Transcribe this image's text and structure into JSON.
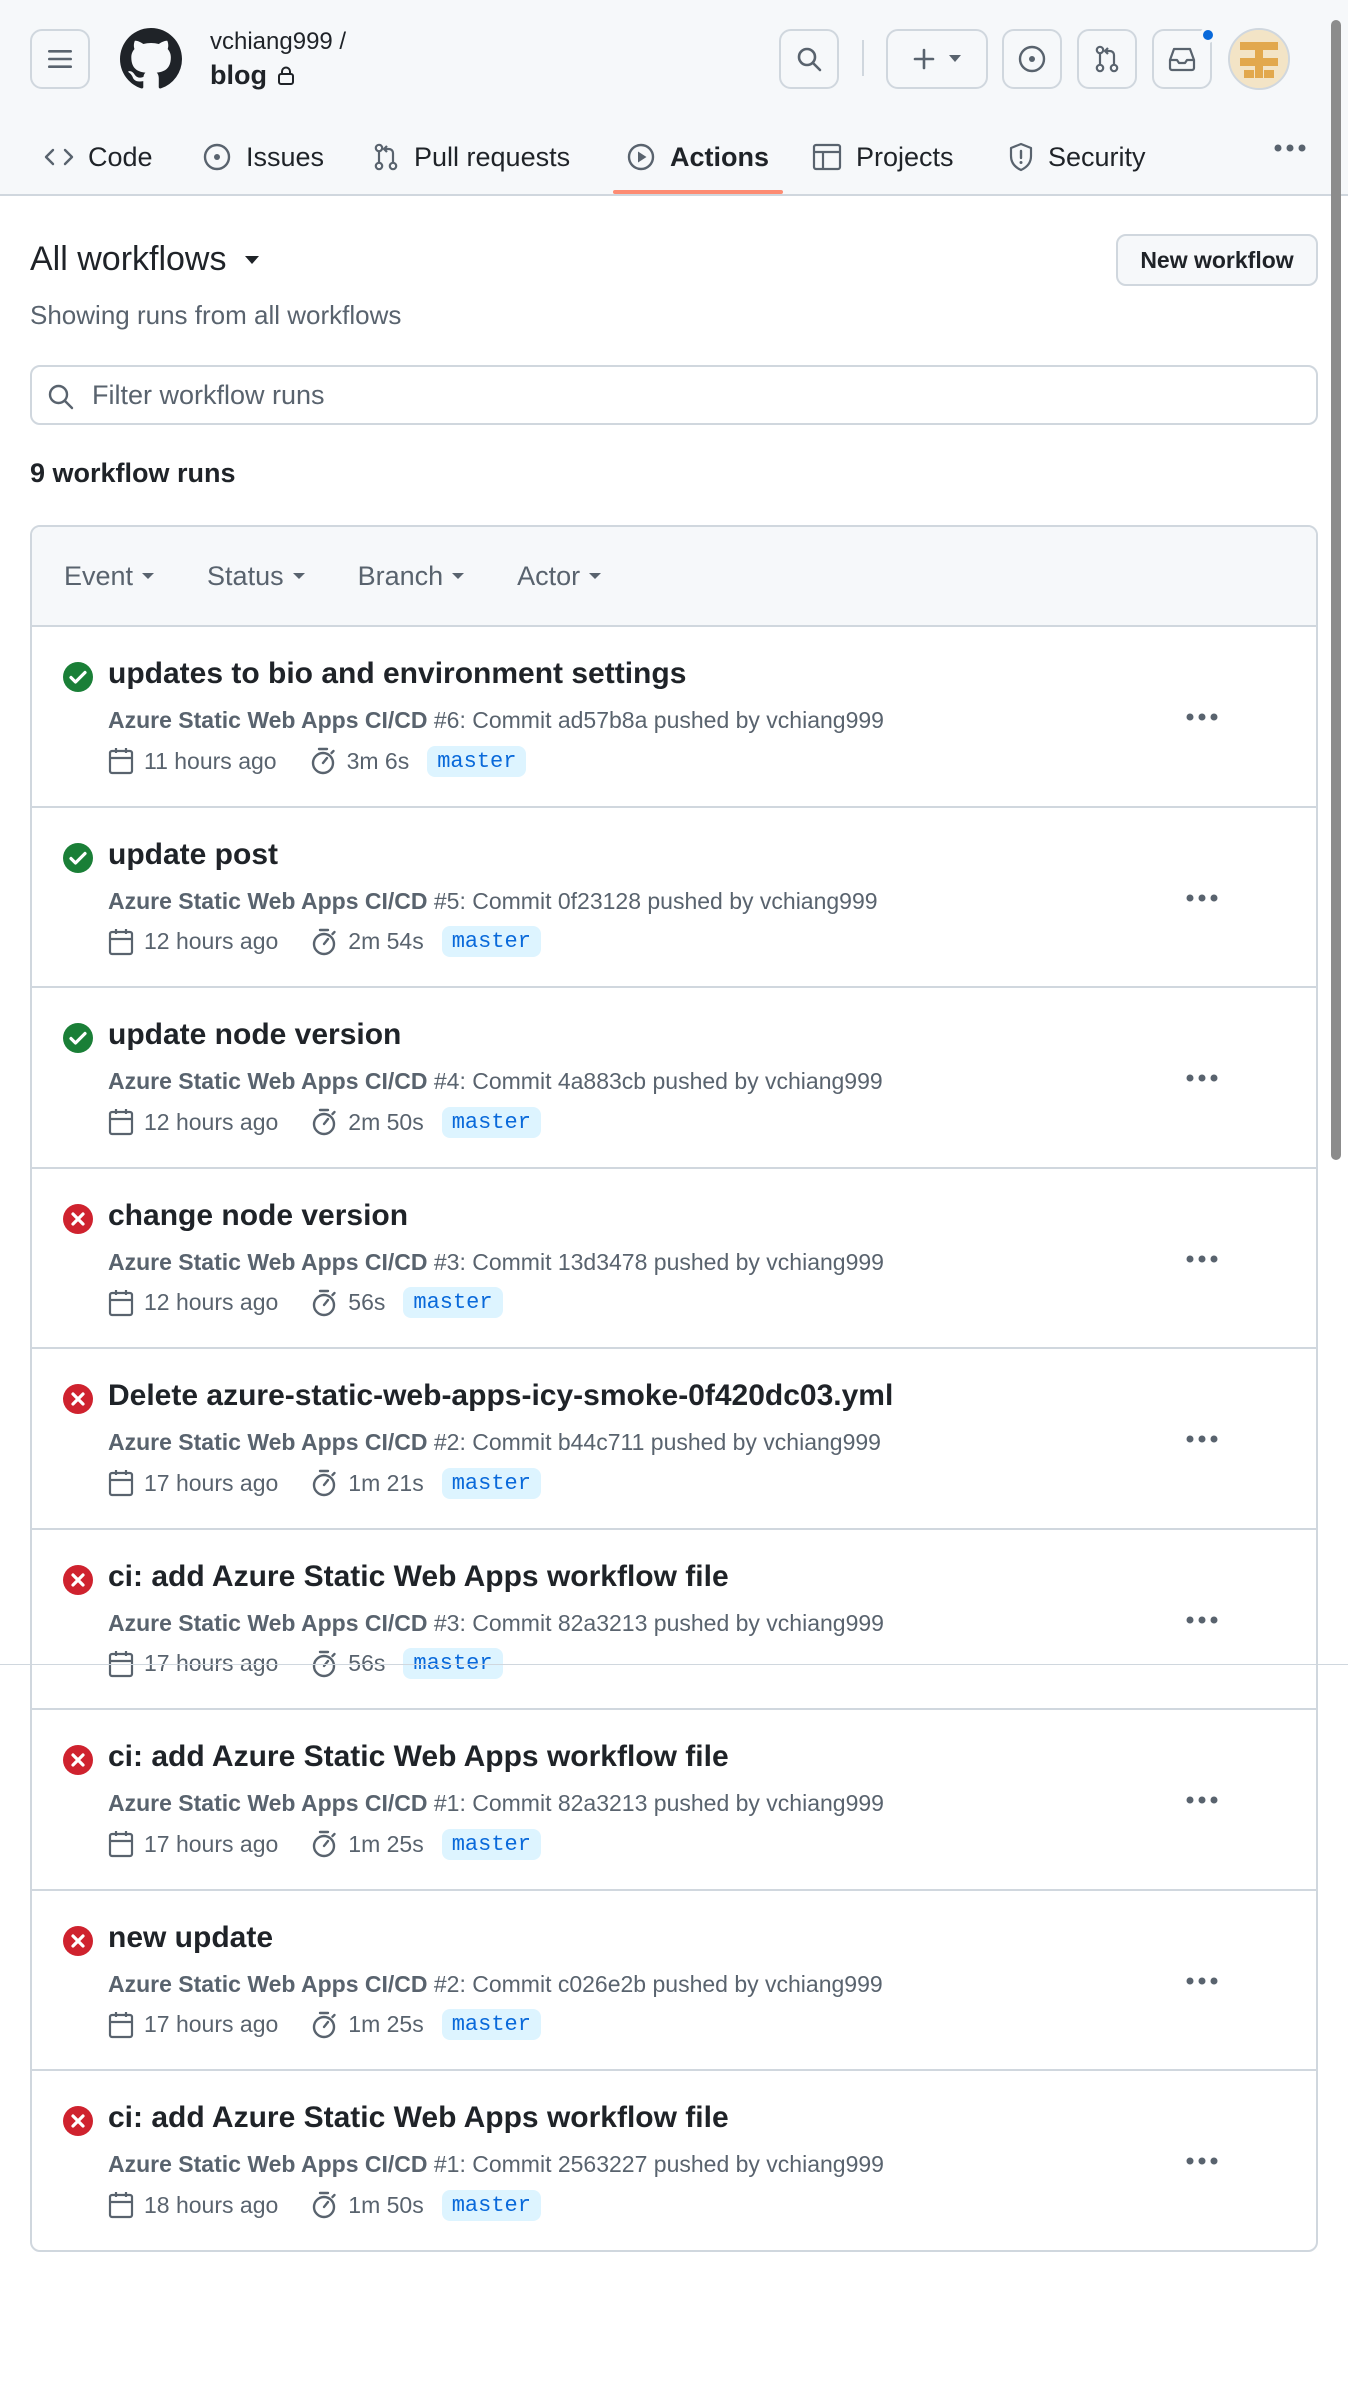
{
  "header": {
    "owner": "vchiang999 /",
    "repo": "blog",
    "tabs": [
      {
        "label": "Code",
        "icon": "code-icon"
      },
      {
        "label": "Issues",
        "icon": "issue-opened-icon"
      },
      {
        "label": "Pull requests",
        "icon": "git-pull-request-icon"
      },
      {
        "label": "Actions",
        "icon": "play-icon",
        "active": true
      },
      {
        "label": "Projects",
        "icon": "table-icon"
      },
      {
        "label": "Security",
        "icon": "shield-icon"
      }
    ]
  },
  "main": {
    "title": "All workflows",
    "subtitle": "Showing runs from all workflows",
    "new_workflow_label": "New workflow",
    "filter_placeholder": "Filter workflow runs",
    "run_count": "9 workflow runs",
    "filters": {
      "event": "Event",
      "status": "Status",
      "branch": "Branch",
      "actor": "Actor"
    }
  },
  "colors": {
    "success": "#1a7f37",
    "failure": "#cf222e",
    "accent": "#0969da",
    "underline": "#fd8c73"
  },
  "runs": [
    {
      "status": "success",
      "title": "updates to bio and environment settings",
      "workflow": "Azure Static Web Apps CI/CD",
      "detail": " #6: Commit ad57b8a pushed by vchiang999",
      "time": "11 hours ago",
      "duration": "3m 6s",
      "branch": "master"
    },
    {
      "status": "success",
      "title": "update post",
      "workflow": "Azure Static Web Apps CI/CD",
      "detail": " #5: Commit 0f23128 pushed by vchiang999",
      "time": "12 hours ago",
      "duration": "2m 54s",
      "branch": "master"
    },
    {
      "status": "success",
      "title": "update node version",
      "workflow": "Azure Static Web Apps CI/CD",
      "detail": " #4: Commit 4a883cb pushed by vchiang999",
      "time": "12 hours ago",
      "duration": "2m 50s",
      "branch": "master"
    },
    {
      "status": "failure",
      "title": "change node version",
      "workflow": "Azure Static Web Apps CI/CD",
      "detail": " #3: Commit 13d3478 pushed by vchiang999",
      "time": "12 hours ago",
      "duration": "56s",
      "branch": "master"
    },
    {
      "status": "failure",
      "title": "Delete azure-static-web-apps-icy-smoke-0f420dc03.yml",
      "workflow": "Azure Static Web Apps CI/CD",
      "detail": " #2: Commit b44c711 pushed by vchiang999",
      "time": "17 hours ago",
      "duration": "1m 21s",
      "branch": "master"
    },
    {
      "status": "failure",
      "title": "ci: add Azure Static Web Apps workflow file",
      "workflow": "Azure Static Web Apps CI/CD",
      "detail": " #3: Commit 82a3213 pushed by vchiang999",
      "time": "17 hours ago",
      "duration": "56s",
      "branch": "master"
    },
    {
      "status": "failure",
      "title": "ci: add Azure Static Web Apps workflow file",
      "workflow": "Azure Static Web Apps CI/CD",
      "detail": " #1: Commit 82a3213 pushed by vchiang999",
      "time": "17 hours ago",
      "duration": "1m 25s",
      "branch": "master"
    },
    {
      "status": "failure",
      "title": "new update",
      "workflow": "Azure Static Web Apps CI/CD",
      "detail": " #2: Commit c026e2b pushed by vchiang999",
      "time": "17 hours ago",
      "duration": "1m 25s",
      "branch": "master"
    },
    {
      "status": "failure",
      "title": "ci: add Azure Static Web Apps workflow file",
      "workflow": "Azure Static Web Apps CI/CD",
      "detail": " #1: Commit 2563227 pushed by vchiang999",
      "time": "18 hours ago",
      "duration": "1m 50s",
      "branch": "master"
    }
  ]
}
